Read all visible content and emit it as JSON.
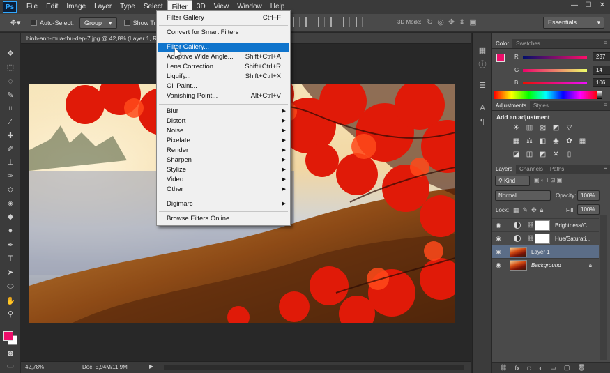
{
  "app": {
    "logo": "Ps"
  },
  "menubar": {
    "items": [
      "File",
      "Edit",
      "Image",
      "Layer",
      "Type",
      "Select",
      "Filter",
      "3D",
      "View",
      "Window",
      "Help"
    ],
    "active": "Filter",
    "window_controls": [
      "—",
      "☐",
      "✕"
    ]
  },
  "options": {
    "auto_select_label": "Auto-Select:",
    "auto_select_value": "Group",
    "show_transform_label": "Show Tran",
    "mode_3d_label": "3D Mode:",
    "workspace": "Essentials"
  },
  "document": {
    "tab_title": "hinh-anh-mua-thu-dep-7.jpg @ 42,8% (Layer 1, R",
    "zoom": "42,78%",
    "doc_info": "Doc: 5,94M/11,9M"
  },
  "filter_menu": {
    "items": [
      {
        "label": "Filter Gallery",
        "shortcut": "Ctrl+F"
      },
      {
        "label": "Convert for Smart Filters",
        "shortcut": ""
      },
      {
        "label": "Filter Gallery...",
        "shortcut": ""
      },
      {
        "label": "Adaptive Wide Angle...",
        "shortcut": "Shift+Ctrl+A"
      },
      {
        "label": "Lens Correction...",
        "shortcut": "Shift+Ctrl+R"
      },
      {
        "label": "Liquify...",
        "shortcut": "Shift+Ctrl+X"
      },
      {
        "label": "Oil Paint...",
        "shortcut": ""
      },
      {
        "label": "Vanishing Point...",
        "shortcut": "Alt+Ctrl+V"
      },
      {
        "label": "Blur",
        "shortcut": ""
      },
      {
        "label": "Distort",
        "shortcut": ""
      },
      {
        "label": "Noise",
        "shortcut": ""
      },
      {
        "label": "Pixelate",
        "shortcut": ""
      },
      {
        "label": "Render",
        "shortcut": ""
      },
      {
        "label": "Sharpen",
        "shortcut": ""
      },
      {
        "label": "Stylize",
        "shortcut": ""
      },
      {
        "label": "Video",
        "shortcut": ""
      },
      {
        "label": "Other",
        "shortcut": ""
      },
      {
        "label": "Digimarc",
        "shortcut": ""
      },
      {
        "label": "Browse Filters Online...",
        "shortcut": ""
      }
    ],
    "highlighted_index": 2,
    "submenu_arrow": "▶"
  },
  "color_panel": {
    "tabs": [
      "Color",
      "Swatches"
    ],
    "r_label": "R",
    "g_label": "G",
    "b_label": "B",
    "r": "237",
    "g": "14",
    "b": "106",
    "foreground": "#ED0E6A"
  },
  "adjustments_panel": {
    "tabs": [
      "Adjustments",
      "Styles"
    ],
    "title": "Add an adjustment"
  },
  "layers_panel": {
    "tabs": [
      "Layers",
      "Channels",
      "Paths"
    ],
    "kind": "Kind",
    "blend_mode": "Normal",
    "opacity_label": "Opacity:",
    "opacity": "100%",
    "lock_label": "Lock:",
    "fill_label": "Fill:",
    "fill": "100%",
    "layers": [
      {
        "name": "Brightness/C...",
        "type": "adjustment"
      },
      {
        "name": "Hue/Saturati...",
        "type": "adjustment"
      },
      {
        "name": "Layer 1",
        "type": "image"
      },
      {
        "name": "Background",
        "type": "background"
      }
    ],
    "selected_layer": "Layer 1"
  },
  "colors": {
    "menu_highlight": "#0F74CC",
    "layer_selected": "#5B6D87",
    "foreground": "#ED0E6A"
  }
}
